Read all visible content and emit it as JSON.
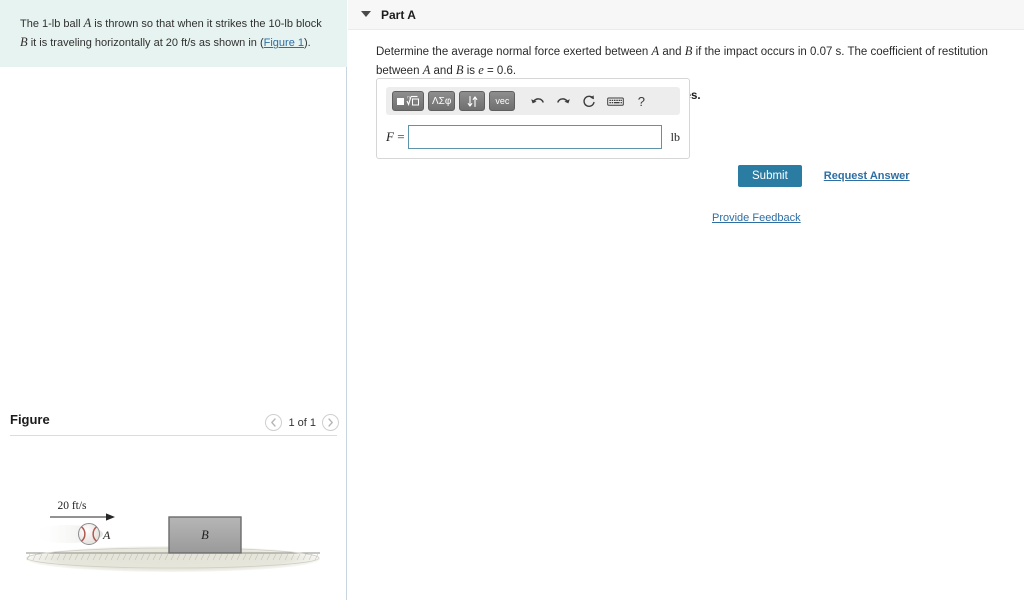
{
  "problem": {
    "text_parts": [
      "The 1-lb ball ",
      "A",
      " is thrown so that when it strikes the 10-lb block ",
      "B",
      " it is traveling horizontally at 20 ft/s as shown in (",
      "Figure 1",
      ")."
    ],
    "ball_label": "A",
    "block_label": "B",
    "figure_link_label": "Figure 1"
  },
  "figure": {
    "title": "Figure",
    "pager_label": "1 of 1",
    "prev_icon": "chevron-left-icon",
    "next_icon": "chevron-right-icon",
    "diagram": {
      "velocity_label": "20 ft/s",
      "ball_label": "A",
      "block_label": "B",
      "ground_color": "#ddddd2",
      "block_fill": "#a8a8a8",
      "block_stroke": "#6b6b6b",
      "ball_seam_color": "#b05a4e"
    }
  },
  "part": {
    "title": "Part A",
    "caret_icon": "chevron-down-icon",
    "question": {
      "segments": [
        "Determine the average normal force exerted between ",
        "A",
        " and ",
        "B",
        " if the impact occurs in 0.07 s. The coefficient of restitution between ",
        "A",
        " and ",
        "B",
        " is ",
        "e",
        " = 0.6."
      ],
      "impact_time": "0.07 s",
      "restitution_symbol": "e",
      "restitution_value": "0.6",
      "instruction": "Express your answer in pounds to three significant figures."
    }
  },
  "answer_widget": {
    "toolbar": {
      "buttons": [
        {
          "name": "template-radical-button",
          "label": "■√□"
        },
        {
          "name": "greek-symbols-button",
          "label": "ΛΣφ"
        },
        {
          "name": "updown-arrows-button",
          "label": "↓↑"
        },
        {
          "name": "vector-button",
          "label": "vec"
        }
      ],
      "icons": [
        {
          "name": "undo-icon",
          "label": "undo"
        },
        {
          "name": "redo-icon",
          "label": "redo"
        },
        {
          "name": "reset-icon",
          "label": "reset"
        },
        {
          "name": "keyboard-icon",
          "label": "keyboard"
        },
        {
          "name": "help-icon",
          "label": "?"
        }
      ]
    },
    "field": {
      "label": "F",
      "equals": "=",
      "value": "",
      "placeholder": "",
      "units": "lb",
      "border_color": "#5d93ab"
    }
  },
  "actions": {
    "submit_label": "Submit",
    "submit_color": "#2a7ca3",
    "request_answer_label": "Request Answer",
    "provide_feedback_label": "Provide Feedback",
    "link_color": "#2d6ea3"
  },
  "theme": {
    "problem_panel_bg": "#e7f3f0",
    "header_bg": "#f7f7f7",
    "divider": "#c8d4e0"
  }
}
